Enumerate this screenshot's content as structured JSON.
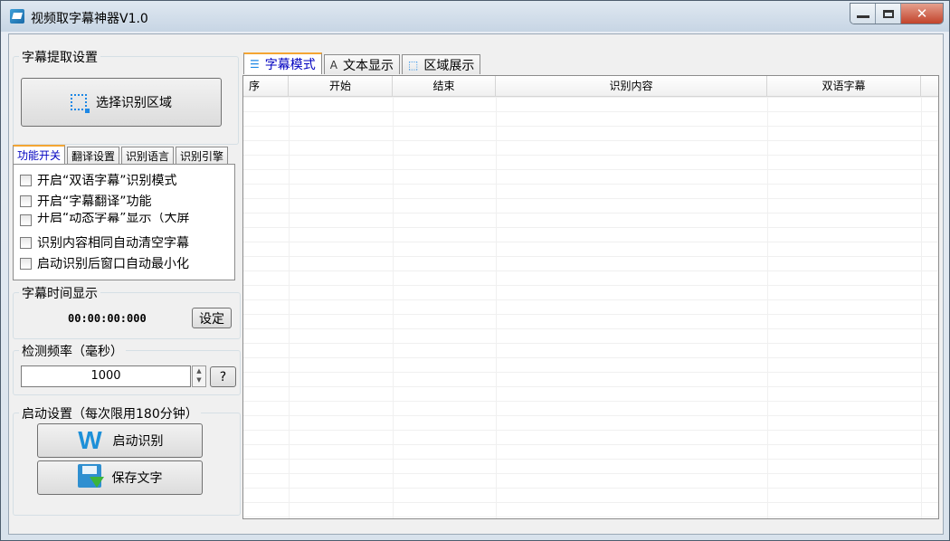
{
  "window": {
    "title": "视频取字幕神器V1.0"
  },
  "left": {
    "extract_group_title": "字幕提取设置",
    "select_area_button": "选择识别区域",
    "tabs": [
      "功能开关",
      "翻译设置",
      "识别语言",
      "识别引擎"
    ],
    "options": [
      {
        "label": "开启“双语字幕”识别模式",
        "checked": false
      },
      {
        "label": "开启“字幕翻译”功能",
        "checked": false
      },
      {
        "label": "开启“动态字幕”显示（大屏",
        "checked": false
      },
      {
        "label": "识别内容相同自动清空字幕",
        "checked": false
      },
      {
        "label": "启动识别后窗口自动最小化",
        "checked": false
      }
    ],
    "time_group_title": "字幕时间显示",
    "time_value": "00:00:00:000",
    "set_button": "设定",
    "freq_group_title": "检测频率（毫秒）",
    "freq_value": "1000",
    "help_button": "?",
    "start_group_title": "启动设置（每次限用180分钟）",
    "start_button": "启动识别",
    "save_button": "保存文字"
  },
  "right": {
    "tabs": [
      {
        "label": "字幕模式",
        "icon": "list-icon"
      },
      {
        "label": "文本显示",
        "icon": "text-icon"
      },
      {
        "label": "区域展示",
        "icon": "region-icon"
      }
    ],
    "columns": [
      "序",
      "开始",
      "结束",
      "识别内容",
      "双语字幕"
    ]
  }
}
